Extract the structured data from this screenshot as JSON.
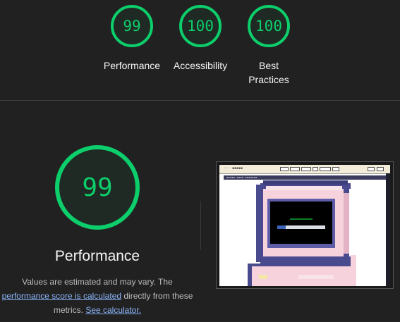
{
  "top_gauges": [
    {
      "score": "99",
      "label": "Performance"
    },
    {
      "score": "100",
      "label": "Accessibility"
    },
    {
      "score": "100",
      "label": "Best Practices"
    }
  ],
  "performance": {
    "score": "99",
    "title": "Performance",
    "desc_pre": "Values are estimated and may vary. The",
    "link1": "performance score is calculated",
    "desc_mid": "directly from these metrics.",
    "link2": "See calculator."
  },
  "colors": {
    "pass": "#0cce6b",
    "background": "#212121",
    "link": "#8ab4f8"
  },
  "screenshot": {
    "icon": "page-screenshot-thumbnail"
  }
}
